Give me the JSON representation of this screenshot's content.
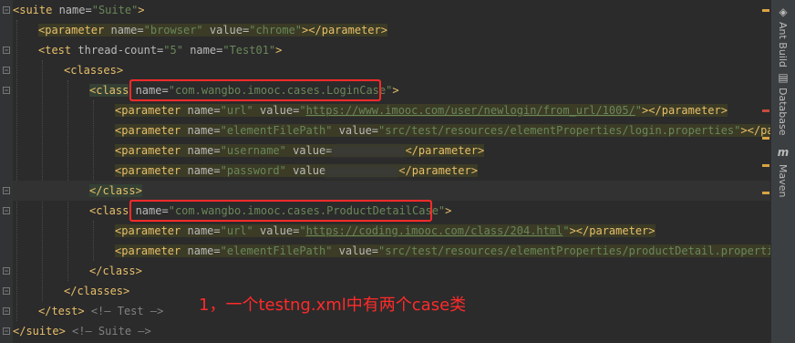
{
  "code": {
    "l1": {
      "open": "<",
      "tag": "suite",
      "attr": " name=",
      "val": "\"Suite\"",
      "close": ">"
    },
    "l2": {
      "open": "<",
      "tag": "parameter",
      "attr1": " name=",
      "val1": "\"browser\"",
      "attr2": " value=",
      "val2": "\"chrome\"",
      "close": "></",
      "tag2": "parameter",
      "end": ">"
    },
    "l3": {
      "open": "<",
      "tag": "test",
      "attr1": " thread-count=",
      "val1": "\"5\"",
      "attr2": " name=",
      "val2": "\"Test01\"",
      "close": ">"
    },
    "l4": {
      "open": "<",
      "tag": "classes",
      "close": ">"
    },
    "l5": {
      "open": "<",
      "tag": "class",
      "attr": " name=",
      "val": "\"com.wangbo.imooc.cases.LoginCase\"",
      "close": ">"
    },
    "l6": {
      "open": "<",
      "tag": "parameter",
      "attr1": " name=",
      "val1": "\"url\"",
      "attr2": " value=",
      "q": "\"",
      "link": "https://www.imooc.com/user/newlogin/from_url/1005/",
      "q2": "\"",
      "close": "></",
      "tag2": "parameter",
      "end": ">"
    },
    "l7": {
      "open": "<",
      "tag": "parameter",
      "attr1": " name=",
      "val1": "\"elementFilePath\"",
      "attr2": " value=",
      "val2": "\"src/test/resources/elementProperties/login.properties\"",
      "close": "></",
      "tag2": "parame"
    },
    "l8": {
      "open": "<",
      "tag": "parameter",
      "attr1": " name=",
      "val1": "\"username\"",
      "attr2": " value=",
      "close": "</",
      "tag2": "parameter",
      "end": ">"
    },
    "l9": {
      "open": "<",
      "tag": "parameter",
      "attr1": " name=",
      "val1": "\"password\"",
      "attr2": " value",
      "close": "</",
      "tag2": "parameter",
      "end": ">"
    },
    "l10": {
      "open": "</",
      "tag": "class",
      "close": ">"
    },
    "l11": {
      "open": "<",
      "tag": "class",
      "attr": " name=",
      "val": "\"com.wangbo.imooc.cases.ProductDetailCase\"",
      "close": ">"
    },
    "l12": {
      "open": "<",
      "tag": "parameter",
      "attr1": " name=",
      "val1": "\"url\"",
      "attr2": " value=",
      "q": "\"",
      "link": "https://coding.imooc.com/class/204.html",
      "q2": "\"",
      "close": "></",
      "tag2": "parameter",
      "end": ">"
    },
    "l13": {
      "open": "<",
      "tag": "parameter",
      "attr1": " name=",
      "val1": "\"elementFilePath\"",
      "attr2": " value=",
      "val2": "\"src/test/resources/elementProperties/productDetail.properties"
    },
    "l14": {
      "open": "</",
      "tag": "class",
      "close": ">"
    },
    "l15": {
      "open": "</",
      "tag": "classes",
      "close": ">"
    },
    "l16": {
      "open": "</",
      "tag": "test",
      "close": ">",
      "cmt": " <!— Test —>"
    },
    "l17": {
      "open": "</",
      "tag": "suite",
      "close": ">",
      "cmt": " <!— Suite —>"
    }
  },
  "annotation": "1，一个testng.xml中有两个case类",
  "sidebar": {
    "tabs": [
      {
        "label": "Ant Build",
        "icon": "ant-icon"
      },
      {
        "label": "Database",
        "icon": "database-icon"
      },
      {
        "label": "Maven",
        "icon": "maven-icon",
        "glyph": "m"
      }
    ]
  },
  "colors": {
    "tag": "#e8bf6a",
    "value": "#6a8759",
    "attr": "#bababa",
    "highlight": "#ff2a2a",
    "background": "#2b2b2b"
  }
}
